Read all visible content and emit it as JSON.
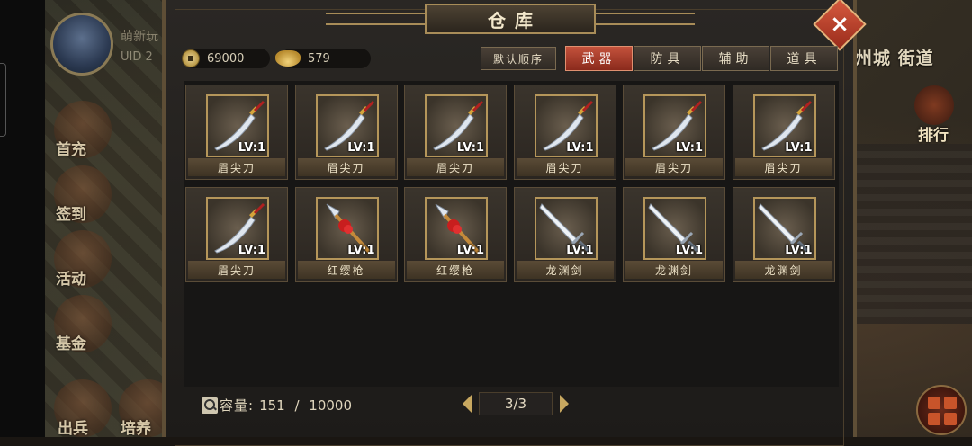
{
  "hud": {
    "player_name": "萌新玩",
    "uid_label": "UID",
    "uid_value": "2",
    "location": "凌州城 街道",
    "side_buttons": [
      "首充",
      "签到",
      "活动",
      "基金",
      "出兵",
      "培养"
    ],
    "rank_label": "排行"
  },
  "panel": {
    "title": "仓库",
    "close_icon": "×",
    "currency": {
      "copper": "69000",
      "silver": "579"
    },
    "sort_label": "默认顺序",
    "tabs": [
      {
        "label": "武器",
        "active": true
      },
      {
        "label": "防具",
        "active": false
      },
      {
        "label": "辅助",
        "active": false
      },
      {
        "label": "道具",
        "active": false
      }
    ],
    "items": [
      {
        "name": "眉尖刀",
        "level": "LV:1",
        "icon": "blade-icon"
      },
      {
        "name": "眉尖刀",
        "level": "LV:1",
        "icon": "blade-icon"
      },
      {
        "name": "眉尖刀",
        "level": "LV:1",
        "icon": "blade-icon"
      },
      {
        "name": "眉尖刀",
        "level": "LV:1",
        "icon": "blade-icon"
      },
      {
        "name": "眉尖刀",
        "level": "LV:1",
        "icon": "blade-icon"
      },
      {
        "name": "眉尖刀",
        "level": "LV:1",
        "icon": "blade-icon"
      },
      {
        "name": "眉尖刀",
        "level": "LV:1",
        "icon": "blade-icon"
      },
      {
        "name": "红缨枪",
        "level": "LV:1",
        "icon": "spear-icon"
      },
      {
        "name": "红缨枪",
        "level": "LV:1",
        "icon": "spear-icon"
      },
      {
        "name": "龙渊剑",
        "level": "LV:1",
        "icon": "sword-icon"
      },
      {
        "name": "龙渊剑",
        "level": "LV:1",
        "icon": "sword-icon"
      },
      {
        "name": "龙渊剑",
        "level": "LV:1",
        "icon": "sword-icon"
      }
    ],
    "capacity_label": "容量:",
    "capacity_value": "151 / 10000",
    "page": "3/3"
  }
}
